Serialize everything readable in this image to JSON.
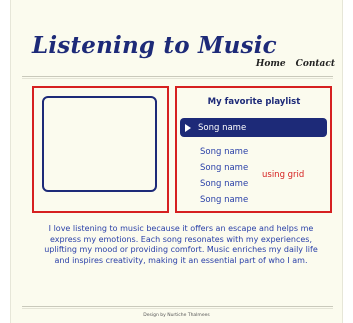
{
  "header": {
    "title": "Listening to Music",
    "nav": [
      "Home",
      "Contact"
    ]
  },
  "playlist": {
    "title": "My favorite playlist",
    "now_playing": "Song name",
    "songs": [
      "Song name",
      "Song name",
      "Song name",
      "Song name"
    ]
  },
  "annotations": {
    "grid_note": "using grid"
  },
  "about": {
    "text": "I love listening to music because it offers an escape and helps me express my emotions. Each song resonates with my experiences, uplifting my mood or providing comfort. Music enriches my daily life and inspires creativity, making it an essential part of who I am."
  },
  "footer": {
    "credit": "Design by Nurtiche Thalmees"
  },
  "colors": {
    "brand": "#1d2a78",
    "link": "#2a40a8",
    "annotation": "#d62020",
    "background": "#fbfbee"
  },
  "icons": {
    "now_playing": "play-icon"
  }
}
